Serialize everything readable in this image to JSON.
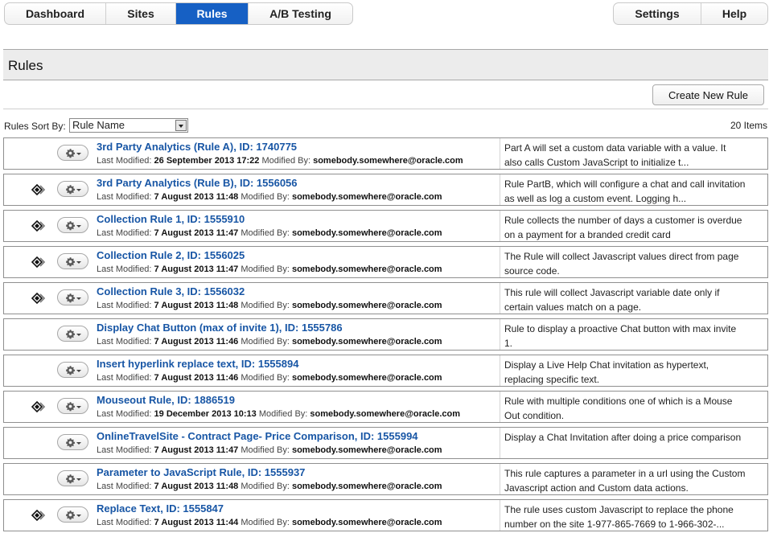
{
  "nav": {
    "tabs": [
      {
        "label": "Dashboard",
        "active": false
      },
      {
        "label": "Sites",
        "active": false
      },
      {
        "label": "Rules",
        "active": true
      },
      {
        "label": "A/B Testing",
        "active": false
      }
    ],
    "settings_label": "Settings",
    "help_label": "Help"
  },
  "page": {
    "title": "Rules",
    "create_button": "Create New Rule",
    "sort_label": "Rules Sort By:",
    "sort_value": "Rule Name",
    "item_count": "20 Items"
  },
  "labels": {
    "last_modified": "Last Modified:",
    "modified_by": "Modified By:"
  },
  "rules": [
    {
      "name": "3rd Party Analytics (Rule A), ID: 1740775",
      "date": "26 September 2013 17:22",
      "by": "somebody.somewhere@oracle.com",
      "desc": "Part A will set a custom data variable with a value. It also calls Custom JavaScript to initialize t...",
      "has_icon": false
    },
    {
      "name": "3rd Party Analytics (Rule B), ID: 1556056",
      "date": "7 August 2013 11:48",
      "by": "somebody.somewhere@oracle.com",
      "desc": "Rule PartB, which will configure a chat and call invitation as well as log a custom event. Logging h...",
      "has_icon": true
    },
    {
      "name": "Collection Rule 1, ID: 1555910",
      "date": "7 August 2013 11:47",
      "by": "somebody.somewhere@oracle.com",
      "desc": "Rule collects the number of days a customer is overdue on a payment for a branded credit card",
      "has_icon": true
    },
    {
      "name": "Collection Rule 2, ID: 1556025",
      "date": "7 August 2013 11:47",
      "by": "somebody.somewhere@oracle.com",
      "desc": "The Rule will collect Javascript values direct from page source code.",
      "has_icon": true
    },
    {
      "name": "Collection Rule 3, ID: 1556032",
      "date": "7 August 2013 11:48",
      "by": "somebody.somewhere@oracle.com",
      "desc": "This rule will collect Javascript variable date only if certain values match on a page.",
      "has_icon": true
    },
    {
      "name": "Display Chat Button (max of invite 1), ID: 1555786",
      "date": "7 August 2013 11:46",
      "by": "somebody.somewhere@oracle.com",
      "desc": "Rule to display a proactive Chat button with max invite 1.",
      "has_icon": false
    },
    {
      "name": "Insert hyperlink replace text, ID: 1555894",
      "date": "7 August 2013 11:46",
      "by": "somebody.somewhere@oracle.com",
      "desc": "Display a Live Help Chat invitation as hypertext, replacing specific text.",
      "has_icon": false
    },
    {
      "name": "Mouseout Rule, ID: 1886519",
      "date": "19 December 2013 10:13",
      "by": "somebody.somewhere@oracle.com",
      "desc": "Rule with multiple conditions one of which is a Mouse Out condition.",
      "has_icon": true
    },
    {
      "name": "OnlineTravelSite - Contract Page- Price Comparison, ID: 1555994",
      "date": "7 August 2013 11:47",
      "by": "somebody.somewhere@oracle.com",
      "desc": "Display a Chat Invitation after doing a price comparison",
      "has_icon": false
    },
    {
      "name": "Parameter to JavaScript Rule, ID: 1555937",
      "date": "7 August 2013 11:48",
      "by": "somebody.somewhere@oracle.com",
      "desc": "This rule captures a parameter in a url using the Custom Javascript action and Custom data actions.",
      "has_icon": false
    },
    {
      "name": "Replace Text, ID: 1555847",
      "date": "7 August 2013 11:44",
      "by": "somebody.somewhere@oracle.com",
      "desc": "The rule uses custom Javascript to replace the phone number on the site 1-977-865-7669 to 1-966-302-...",
      "has_icon": true
    }
  ]
}
